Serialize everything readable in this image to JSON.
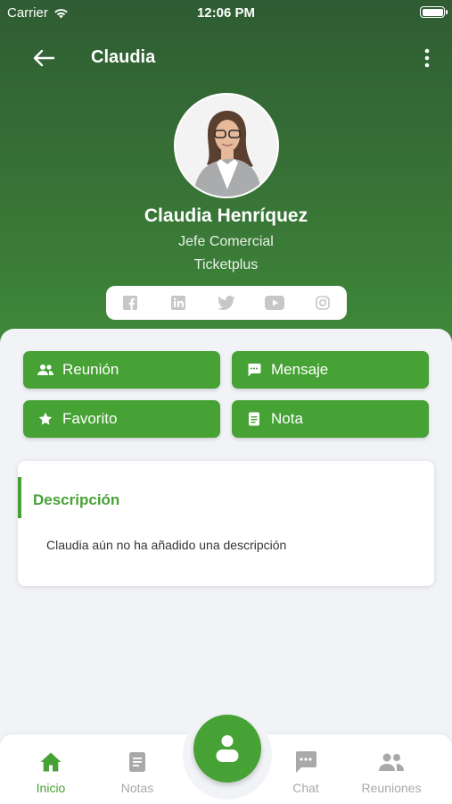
{
  "status_bar": {
    "carrier": "Carrier",
    "time": "12:06 PM"
  },
  "navbar": {
    "title": "Claudia"
  },
  "profile": {
    "name": "Claudia Henríquez",
    "role": "Jefe Comercial",
    "company": "Ticketplus",
    "social": [
      "facebook-icon",
      "linkedin-icon",
      "twitter-icon",
      "youtube-icon",
      "instagram-icon"
    ]
  },
  "actions": {
    "meeting": "Reunión",
    "message": "Mensaje",
    "favorite": "Favorito",
    "note": "Nota"
  },
  "description": {
    "title": "Descripción",
    "text": "Claudia aún no ha añadido una descripción"
  },
  "tabbar": {
    "home": "Inicio",
    "notes": "Notas",
    "chat": "Chat",
    "meetings": "Reuniones"
  },
  "colors": {
    "primary": "#47a235",
    "header_dark": "#2f5c33",
    "header_light": "#3f8a3a",
    "inactive": "#a9a9a9"
  }
}
